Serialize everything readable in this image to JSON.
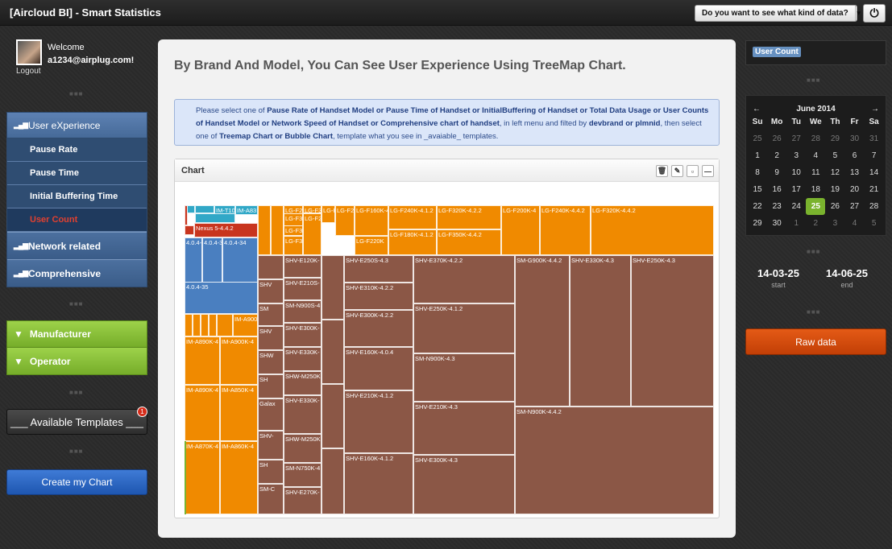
{
  "header": {
    "title": "[Aircloud BI] - Smart Statistics",
    "data_select_label": "Do you want to see what kind of data?",
    "power_icon": "power-icon"
  },
  "user": {
    "welcome": "Welcome",
    "email": "a1234@airplug.com!",
    "logout": "Logout"
  },
  "nav": {
    "user_experience": "User eXperience",
    "sub": [
      "Pause Rate",
      "Pause Time",
      "Initial Buffering Time",
      "User Count"
    ],
    "network": "Network related",
    "comprehensive": "Comprehensive"
  },
  "filters": {
    "manufacturer": "Manufacturer",
    "operator": "Operator"
  },
  "templates": {
    "label": "___ Available Templates ___",
    "badge": "1"
  },
  "create_label": "Create my Chart",
  "main": {
    "heading": "By Brand And Model, You Can See User Experience Using TreeMap Chart.",
    "info": {
      "t1": "Please select one of ",
      "b1": "Pause Rate of Handset Model or Pause Time of Handset or InitialBuffering of Handset or Total Data Usage or User Counts of Handset Model or Network Speed of Handset or Comprehensive chart of handset",
      "t2": ", in left menu and filted by ",
      "b2": "devbrand or plmnid",
      "t3": ", then select one of ",
      "b3": "Treemap Chart or Bubble Chart",
      "t4": ", template what you see in _avaiable_ templates."
    },
    "chart_title": "Chart"
  },
  "treemap_labels": {
    "IM-T10": "IM-T10",
    "IM-A83": "IM-A83",
    "Nexus 5-4.4.2": "Nexus 5-4.4.2",
    "4.0.4-3": "4.0.4-3",
    "4.0.4-32": "4.0.4-32",
    "4.0.4-34": "4.0.4-34",
    "4.0.4-35": "4.0.4-35",
    "IM-A900K-4": "IM-A900K-4",
    "IM-A890K-4": "IM-A890K-4",
    "IM-A900K-4b": "IM-A900K-4",
    "IM-A890K-4b": "IM-A890K-4",
    "IM-A850K-4": "IM-A850K-4",
    "IM-A870K-4": "IM-A870K-4",
    "IM-A860K-4": "IM-A860K-4",
    "LG-F240": "LG-F240",
    "LG-F34": "LG-F34",
    "LG-F32": "LG-F32",
    "LG-F30": "LG-F30",
    "LG-F32b": "LG-F32",
    "LG-F220": "LG-F220",
    "LG-F160K": "LG-F160K-4.1",
    "LG-F240K-4.1.2": "LG-F240K-4.1.2",
    "LG-F320K-4.2.2": "LG-F320K-4.2.2",
    "LG-F220K": "LG-F220K",
    "LG-F180K-4.1.2": "LG-F180K-4.1.2",
    "LG-F350K-4.4.2": "LG-F350K-4.4.2",
    "LG-F200K-4": "LG-F200K-4",
    "LG-F240K-4.4.2": "LG-F240K-4.4.2",
    "LG-F320K-4.4.2": "LG-F320K-4.4.2",
    "SHV-E120K": "SHV-E120K-",
    "SHV-E210S": "SHV-E210S-",
    "SM-N900S": "SM-N900S-4",
    "SHV-E300K": "SHV-E300K-",
    "SHV-E330K": "SHV-E330K-",
    "SHW-M250K": "SHW-M250K",
    "SHV-E330K-b": "SHV-E330K-",
    "SHW-M250Kb": "SHW-M250K",
    "SM-N750K": "SM-N750K-4",
    "SHV-E270K": "SHV-E270K-",
    "SHV-E250S-4.3": "SHV-E250S-4.3",
    "SHV-E310K-4.2.2": "SHV-E310K-4.2.2",
    "SHV-E300K-4.2.2": "SHV-E300K-4.2.2",
    "SHV-E160K-4.0.4": "SHV-E160K-4.0.4",
    "SHV-E210K-4.1.2": "SHV-E210K-4.1.2",
    "SHV-E160K-4.1.2": "SHV-E160K-4.1.2",
    "SHV-E370K-4.2.2": "SHV-E370K-4.2.2",
    "SHV-E250K-4.1.2": "SHV-E250K-4.1.2",
    "SM-N900K-4.3": "SM-N900K-4.3",
    "SHV-E210K-4.3": "SHV-E210K-4.3",
    "SHV-E300K-4.3": "SHV-E300K-4.3",
    "SM-G900K-4.4.2": "SM-G900K-4.4.2",
    "SHV-E330K-4.3": "SHV-E330K-4.3",
    "SHV-E250K-4.3": "SHV-E250K-4.3",
    "SM-N900K-4.4.2": "SM-N900K-4.4.2",
    "Galaxy": "Galax",
    "Nexus": "Nexus",
    "SHV": "SHV",
    "SHW": "SHW",
    "SM": "SM",
    "SH": "SH",
    "SM-C": "SM-C",
    "SHV-s": "SHV-",
    "SH2": "SH",
    "SM2": "SM"
  },
  "right": {
    "user_count_tag": "User Count",
    "calendar": {
      "month": "June 2014",
      "dow": [
        "Su",
        "Mo",
        "Tu",
        "We",
        "Th",
        "Fr",
        "Sa"
      ],
      "days": [
        "25",
        "26",
        "27",
        "28",
        "29",
        "30",
        "31",
        "1",
        "2",
        "3",
        "4",
        "5",
        "6",
        "7",
        "8",
        "9",
        "10",
        "11",
        "12",
        "13",
        "14",
        "15",
        "16",
        "17",
        "18",
        "19",
        "20",
        "21",
        "22",
        "23",
        "24",
        "25",
        "26",
        "27",
        "28",
        "29",
        "30",
        "1",
        "2",
        "3",
        "4",
        "5"
      ],
      "today": "25"
    },
    "start_date": "14-03-25",
    "start_label": "start",
    "end_date": "14-06-25",
    "end_label": "end",
    "raw_button": "Raw data"
  },
  "colors": {
    "lg": "#f08a00",
    "samsung": "#8b5746",
    "pantech": "#f08a00",
    "blue": "#4a7fc0",
    "red": "#c8351e",
    "teal": "#31a8c7",
    "green": "#7ab32e"
  }
}
